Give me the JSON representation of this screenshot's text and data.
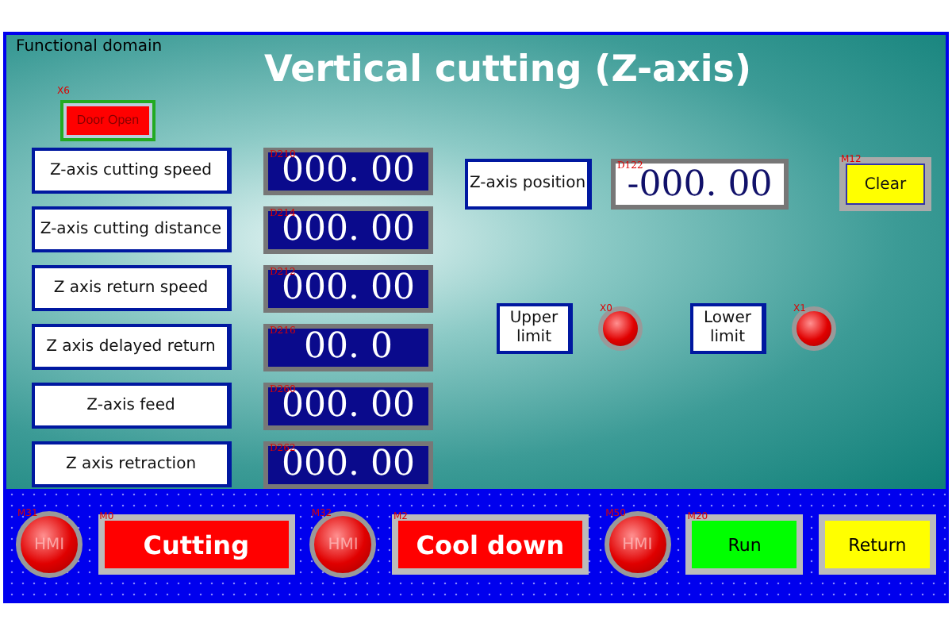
{
  "area_label": "Functional domain",
  "title": "Vertical cutting (Z-axis)",
  "door_button": {
    "tag": "X6",
    "label": "Door Open"
  },
  "parameters": [
    {
      "label": "Z-axis cutting speed",
      "tag": "D210",
      "value": "000. 00"
    },
    {
      "label": "Z-axis cutting distance",
      "tag": "D214",
      "value": "000. 00"
    },
    {
      "label": "Z axis return speed",
      "tag": "D212",
      "value": "000. 00"
    },
    {
      "label": "Z axis delayed return",
      "tag": "D216",
      "value": "00. 0"
    },
    {
      "label": "Z-axis feed",
      "tag": "D260",
      "value": "000. 00"
    },
    {
      "label": "Z axis retraction",
      "tag": "D262",
      "value": "000. 00"
    }
  ],
  "position": {
    "label": "Z-axis position",
    "tag": "D122",
    "value": "-000. 00"
  },
  "clear_button": {
    "tag": "M12",
    "label": "Clear"
  },
  "limits": [
    {
      "label": "Upper limit",
      "tag": "X0",
      "on": true
    },
    {
      "label": "Lower limit",
      "tag": "X1",
      "on": true
    }
  ],
  "bottom_bar": [
    {
      "kind": "lamp",
      "tag": "M31",
      "text": "HMI",
      "on": true
    },
    {
      "kind": "button",
      "tag": "M0",
      "label": "Cutting",
      "color": "#ff0000"
    },
    {
      "kind": "lamp",
      "tag": "M32",
      "text": "HMI",
      "on": true
    },
    {
      "kind": "button",
      "tag": "M2",
      "label": "Cool down",
      "color": "#ff0000"
    },
    {
      "kind": "lamp",
      "tag": "M50",
      "text": "HMI",
      "on": true
    },
    {
      "kind": "button",
      "tag": "M20",
      "label": "Run",
      "color": "#00ff00"
    },
    {
      "kind": "button",
      "label": "Return",
      "color": "#ffff00"
    }
  ]
}
